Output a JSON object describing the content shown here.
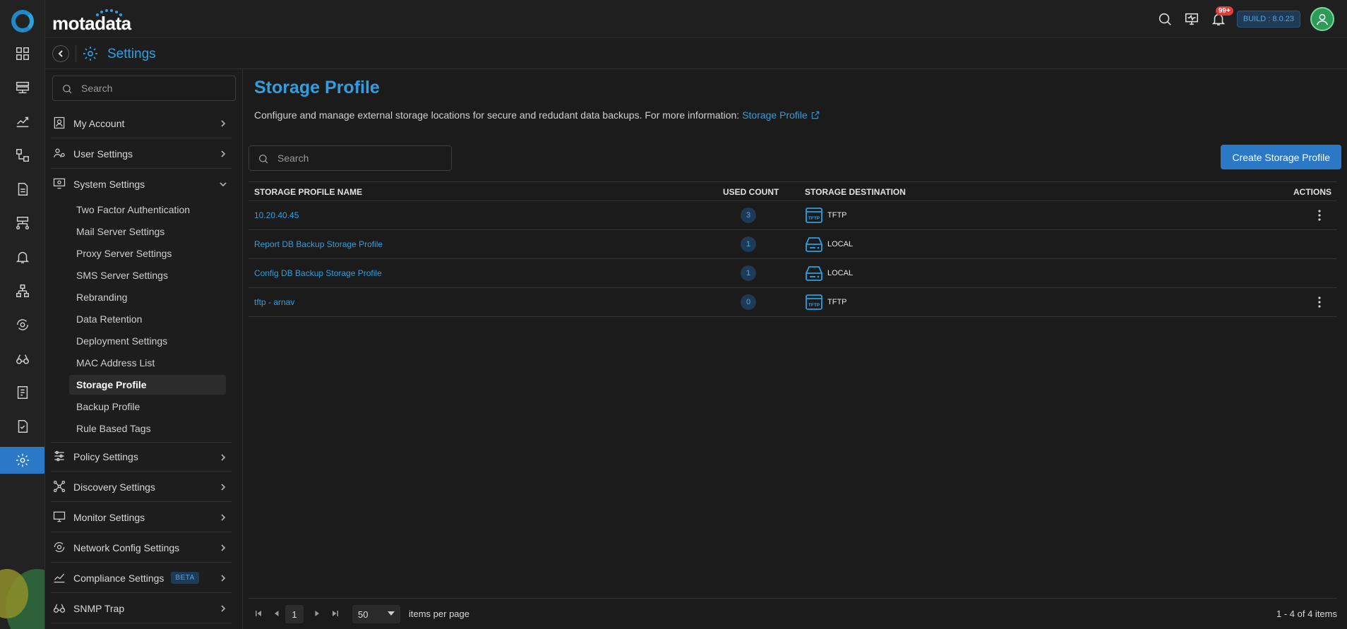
{
  "app": {
    "brand": "motadata",
    "build_tag": "BUILD : 8.0.23",
    "notification_count": "99+",
    "accent_color": "#2f9fe0"
  },
  "header": {
    "section_title": "Settings"
  },
  "rail": {
    "icons": [
      "dashboard-icon",
      "server-icon",
      "metrics-icon",
      "topology-icon",
      "report-icon",
      "network-icon",
      "alert-icon",
      "hierarchy-icon",
      "refresh-eye-icon",
      "binoculars-icon",
      "log-icon",
      "compliance-icon",
      "settings-icon"
    ],
    "active": "settings-icon"
  },
  "sidebar": {
    "search_placeholder": "Search",
    "groups_top": [
      {
        "label": "My Account",
        "icon": "user-badge-icon"
      },
      {
        "label": "User Settings",
        "icon": "users-gear-icon"
      },
      {
        "label": "System Settings",
        "icon": "system-gear-icon"
      }
    ],
    "system_items": [
      "Two Factor Authentication",
      "Mail Server Settings",
      "Proxy Server Settings",
      "SMS Server Settings",
      "Rebranding",
      "Data Retention",
      "Deployment Settings",
      "MAC Address List",
      "Storage Profile",
      "Backup Profile",
      "Rule Based Tags"
    ],
    "active_item": "Storage Profile",
    "groups_bottom": [
      {
        "label": "Policy Settings",
        "icon": "sliders-icon"
      },
      {
        "label": "Discovery Settings",
        "icon": "discovery-icon"
      },
      {
        "label": "Monitor Settings",
        "icon": "monitor-icon"
      },
      {
        "label": "Network Config Settings",
        "icon": "network-config-icon"
      },
      {
        "label": "Compliance Settings",
        "icon": "compliance-chart-icon",
        "badge": "BETA"
      },
      {
        "label": "SNMP Trap",
        "icon": "binoculars-icon"
      }
    ]
  },
  "main": {
    "title": "Storage Profile",
    "description": "Configure and manage external storage locations for secure and redudant data backups. For more information:",
    "description_link": "Storage Profile",
    "search_placeholder": "Search",
    "create_button": "Create Storage Profile",
    "columns": {
      "name": "STORAGE PROFILE NAME",
      "used_count": "USED COUNT",
      "destination": "STORAGE DESTINATION",
      "actions": "ACTIONS"
    },
    "rows": [
      {
        "name": "10.20.40.45",
        "used_count": "3",
        "destination": "TFTP",
        "dest_icon": "tftp-icon",
        "has_actions": true
      },
      {
        "name": "Report DB Backup Storage Profile",
        "used_count": "1",
        "destination": "LOCAL",
        "dest_icon": "local-disk-icon",
        "has_actions": false
      },
      {
        "name": "Config DB Backup Storage Profile",
        "used_count": "1",
        "destination": "LOCAL",
        "dest_icon": "local-disk-icon",
        "has_actions": false
      },
      {
        "name": "tftp - arnav",
        "used_count": "0",
        "destination": "TFTP",
        "dest_icon": "tftp-icon",
        "has_actions": true
      }
    ]
  },
  "pager": {
    "current_page": "1",
    "page_size": "50",
    "items_per_page_label": "items per page",
    "summary": "1 - 4 of 4 items"
  }
}
